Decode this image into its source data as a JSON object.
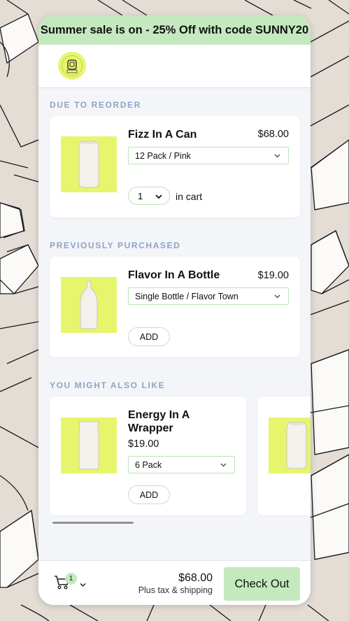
{
  "banner": {
    "text": "Summer sale is on - 25% Off with code SUNNY20"
  },
  "logo": {
    "ring_text": "CONSUMER PRODUCTS",
    "store_text": "STORE"
  },
  "sections": {
    "reorder": {
      "title": "DUE TO REORDER",
      "product": {
        "title": "Fizz In A Can",
        "price": "$68.00",
        "variant": "12 Pack / Pink",
        "quantity": "1",
        "in_cart_label": "in cart"
      }
    },
    "purchased": {
      "title": "PREVIOUSLY PURCHASED",
      "product": {
        "title": "Flavor In A Bottle",
        "price": "$19.00",
        "variant": "Single Bottle / Flavor Town",
        "add_label": "ADD"
      }
    },
    "suggested": {
      "title": "YOU MIGHT ALSO LIKE",
      "products": [
        {
          "title": "Energy In A Wrapper",
          "price": "$19.00",
          "variant": "6 Pack",
          "add_label": "ADD"
        }
      ]
    }
  },
  "footer": {
    "cart_count": "1",
    "total": "$68.00",
    "total_note": "Plus tax & shipping",
    "checkout_label": "Check Out"
  },
  "colors": {
    "accent_green": "#c5e9bf",
    "product_yellow": "#e7f56d",
    "section_title": "#8ea3c6",
    "background": "#e3ddd5"
  },
  "icons": [
    "cart-icon",
    "chevron-down-icon",
    "can-icon",
    "bottle-icon",
    "wrapper-icon",
    "store-logo"
  ]
}
